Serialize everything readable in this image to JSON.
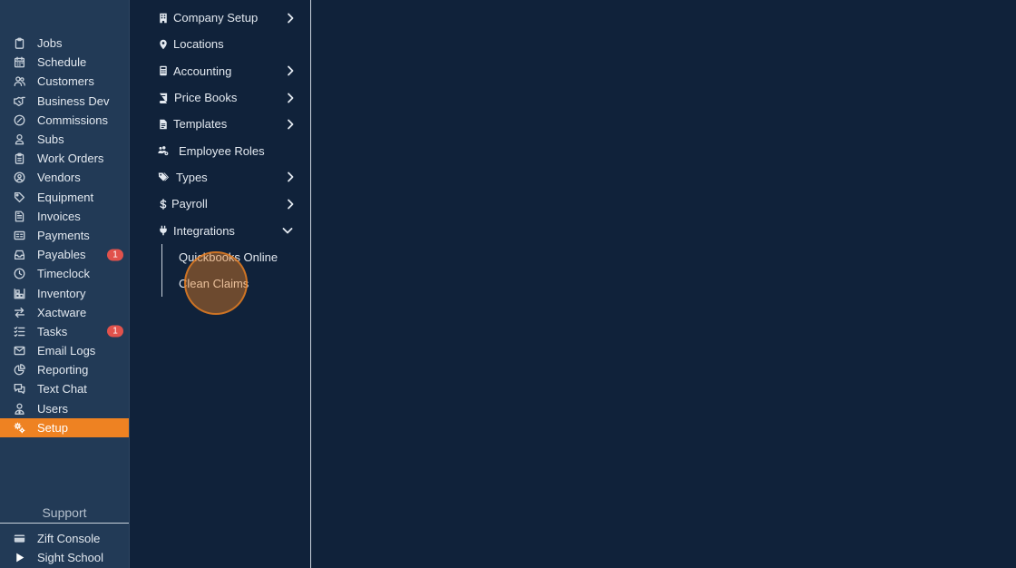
{
  "sidebar": {
    "items": [
      {
        "label": "Jobs",
        "icon": "clipboard-icon"
      },
      {
        "label": "Schedule",
        "icon": "calendar-icon"
      },
      {
        "label": "Customers",
        "icon": "users-icon"
      },
      {
        "label": "Business Dev",
        "icon": "handshake-icon"
      },
      {
        "label": "Commissions",
        "icon": "percent-circle-icon"
      },
      {
        "label": "Subs",
        "icon": "user-icon"
      },
      {
        "label": "Work Orders",
        "icon": "clipboard-list-icon"
      },
      {
        "label": "Vendors",
        "icon": "user-circle-icon"
      },
      {
        "label": "Equipment",
        "icon": "tag-icon"
      },
      {
        "label": "Invoices",
        "icon": "document-icon"
      },
      {
        "label": "Payments",
        "icon": "id-card-icon"
      },
      {
        "label": "Payables",
        "icon": "inbox-icon",
        "badge": "1"
      },
      {
        "label": "Timeclock",
        "icon": "clock-icon"
      },
      {
        "label": "Inventory",
        "icon": "boxes-icon"
      },
      {
        "label": "Xactware",
        "icon": "swap-icon"
      },
      {
        "label": "Tasks",
        "icon": "checklist-icon",
        "badge": "1"
      },
      {
        "label": "Email Logs",
        "icon": "envelope-icon"
      },
      {
        "label": "Reporting",
        "icon": "pie-chart-icon"
      },
      {
        "label": "Text Chat",
        "icon": "chat-icon"
      },
      {
        "label": "Users",
        "icon": "user-tie-icon"
      },
      {
        "label": "Setup",
        "icon": "gears-icon",
        "active": true
      }
    ],
    "support_label": "Support",
    "support_items": [
      {
        "label": "Zift Console",
        "icon": "credit-card-icon"
      },
      {
        "label": "Sight School",
        "icon": "play-icon"
      }
    ]
  },
  "submenu": {
    "items": [
      {
        "label": "Company Setup",
        "icon": "building-icon",
        "chevron": "right"
      },
      {
        "label": "Locations",
        "icon": "map-pin-icon"
      },
      {
        "label": "Accounting",
        "icon": "calculator-icon",
        "chevron": "right"
      },
      {
        "label": "Price Books",
        "icon": "book-icon",
        "chevron": "right"
      },
      {
        "label": "Templates",
        "icon": "file-icon",
        "chevron": "right"
      },
      {
        "label": "Employee Roles",
        "icon": "users-cog-icon"
      },
      {
        "label": "Types",
        "icon": "tags-icon",
        "chevron": "right"
      },
      {
        "label": "Payroll",
        "icon": "dollar-icon",
        "chevron": "right"
      },
      {
        "label": "Integrations",
        "icon": "plug-icon",
        "chevron": "down"
      }
    ],
    "integrations_children": [
      "Quickbooks Online",
      "Clean Claims"
    ]
  },
  "colors": {
    "sidebar_bg": "#223a56",
    "page_bg": "#10223a",
    "accent": "#ee8222",
    "badge": "#e1524c"
  }
}
